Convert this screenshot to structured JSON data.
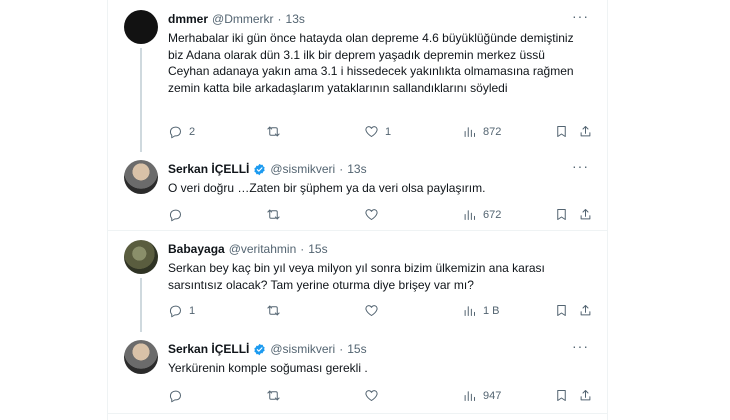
{
  "tweets": [
    {
      "name": "dmmer",
      "handle": "@Dmmerkr",
      "dot": "·",
      "time": "13s",
      "text": "Merhabalar iki gün önce hatayda olan depreme 4.6 büyüklüğünde demiştiniz biz Adana olarak dün 3.1 ilk bir deprem yaşadık depremin merkez üssü Ceyhan adanaya yakın ama 3.1 i hissedecek yakınlıkta olmamasına rağmen zemin katta bile arkadaşlarım yataklarının sallandıklarını söyledi",
      "replies": "2",
      "retweets": "",
      "likes": "1",
      "views": "872"
    },
    {
      "name": "Serkan İÇELLİ",
      "handle": "@sismikveri",
      "dot": "·",
      "time": "13s",
      "text": "O veri doğru …Zaten bir şüphem ya da veri olsa paylaşırım.",
      "replies": "",
      "retweets": "",
      "likes": "",
      "views": "672"
    },
    {
      "name": "Babayaga",
      "handle": "@veritahmin",
      "dot": "·",
      "time": "15s",
      "text": "Serkan bey kaç bin yıl veya milyon yıl sonra bizim ülkemizin ana karası sarsıntısız olacak?  Tam yerine oturma diye brişey var mı?",
      "replies": "1",
      "retweets": "",
      "likes": "",
      "views": "1 B"
    },
    {
      "name": "Serkan İÇELLİ",
      "handle": "@sismikveri",
      "dot": "·",
      "time": "15s",
      "text": "Yerkürenin komple soğuması gerekli .",
      "replies": "",
      "retweets": "",
      "likes": "",
      "views": "947"
    }
  ],
  "more_glyph": "···",
  "colors": {
    "text": "#0f1419",
    "muted": "#536471",
    "verified": "#1d9bf0",
    "border": "#eff3f4"
  },
  "icons": [
    "reply-icon",
    "retweet-icon",
    "like-icon",
    "views-icon",
    "bookmark-icon",
    "share-icon",
    "verified-badge-icon",
    "more-icon"
  ]
}
